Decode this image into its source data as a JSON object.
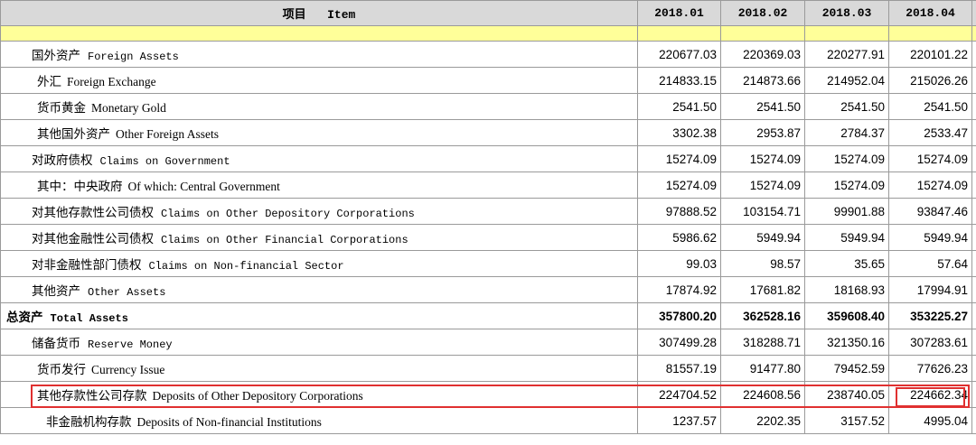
{
  "header": {
    "item_zh": "项目",
    "item_en": "Item",
    "periods": [
      "2018.01",
      "2018.02",
      "2018.03",
      "2018.04"
    ]
  },
  "rows": [
    {
      "zh": "国外资产",
      "en": "Foreign Assets",
      "values": [
        "220677.03",
        "220369.03",
        "220277.91",
        "220101.22"
      ]
    },
    {
      "zh": "外汇",
      "en": "Foreign Exchange",
      "values": [
        "214833.15",
        "214873.66",
        "214952.04",
        "215026.26"
      ]
    },
    {
      "zh": "货币黄金",
      "en": "Monetary Gold",
      "values": [
        "2541.50",
        "2541.50",
        "2541.50",
        "2541.50"
      ]
    },
    {
      "zh": "其他国外资产",
      "en": "Other Foreign Assets",
      "values": [
        "3302.38",
        "2953.87",
        "2784.37",
        "2533.47"
      ]
    },
    {
      "zh": "对政府债权",
      "en": "Claims on Government",
      "values": [
        "15274.09",
        "15274.09",
        "15274.09",
        "15274.09"
      ]
    },
    {
      "zh": "其中：中央政府",
      "en": "Of which: Central Government",
      "values": [
        "15274.09",
        "15274.09",
        "15274.09",
        "15274.09"
      ]
    },
    {
      "zh": "对其他存款性公司债权",
      "en": "Claims on Other Depository Corporations",
      "values": [
        "97888.52",
        "103154.71",
        "99901.88",
        "93847.46"
      ]
    },
    {
      "zh": "对其他金融性公司债权",
      "en": "Claims on Other Financial Corporations",
      "values": [
        "5986.62",
        "5949.94",
        "5949.94",
        "5949.94"
      ]
    },
    {
      "zh": "对非金融性部门债权",
      "en": "Claims on Non-financial Sector",
      "values": [
        "99.03",
        "98.57",
        "35.65",
        "57.64"
      ]
    },
    {
      "zh": "其他资产",
      "en": "Other Assets",
      "values": [
        "17874.92",
        "17681.82",
        "18168.93",
        "17994.91"
      ]
    },
    {
      "zh": "总资产",
      "en": "Total Assets",
      "values": [
        "357800.20",
        "362528.16",
        "359608.40",
        "353225.27"
      ]
    },
    {
      "zh": "储备货币",
      "en": "Reserve Money",
      "values": [
        "307499.28",
        "318288.71",
        "321350.16",
        "307283.61"
      ]
    },
    {
      "zh": "货币发行",
      "en": "Currency Issue",
      "values": [
        "81557.19",
        "91477.80",
        "79452.59",
        "77626.23"
      ]
    },
    {
      "zh": "其他存款性公司存款",
      "en": "Deposits of  Other Depository Corporations",
      "values": [
        "224704.52",
        "224608.56",
        "238740.05",
        "224662.34"
      ]
    },
    {
      "zh": "非金融机构存款",
      "en": "Deposits of  Non-financial Institutions",
      "values": [
        "1237.57",
        "2202.35",
        "3157.52",
        "4995.04"
      ]
    }
  ],
  "highlight_color": "#e03030"
}
